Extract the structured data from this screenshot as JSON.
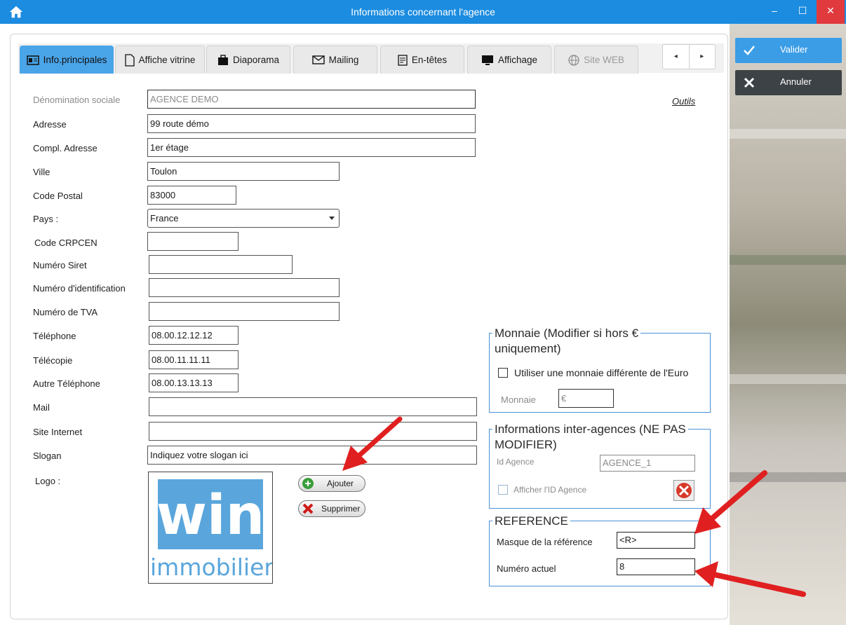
{
  "window": {
    "title": "Informations concernant l'agence",
    "close_label": "✕",
    "minimize_label": "–",
    "maximize_label": "☐"
  },
  "side": {
    "valider_label": "Valider",
    "annuler_label": "Annuler"
  },
  "tabs": [
    {
      "label": "Info.principales",
      "icon": "id-card-icon"
    },
    {
      "label": "Affiche vitrine",
      "icon": "document-icon"
    },
    {
      "label": "Diaporama",
      "icon": "briefcase-icon"
    },
    {
      "label": "Mailing",
      "icon": "envelope-icon"
    },
    {
      "label": "En-têtes",
      "icon": "header-doc-icon"
    },
    {
      "label": "Affichage",
      "icon": "monitor-icon"
    },
    {
      "label": "Site WEB",
      "icon": "globe-icon"
    }
  ],
  "nav": {
    "prev": "◂",
    "next": "▸"
  },
  "outils_label": "Outils",
  "form": {
    "denomination": {
      "label": "Dénomination sociale",
      "value": "AGENCE DEMO"
    },
    "adresse": {
      "label": "Adresse",
      "value": "99 route démo"
    },
    "compl_adresse": {
      "label": "Compl. Adresse",
      "value": "1er étage"
    },
    "ville": {
      "label": "Ville",
      "value": "Toulon"
    },
    "code_postal": {
      "label": "Code Postal",
      "value": "83000"
    },
    "pays": {
      "label": "Pays :",
      "value": "France"
    },
    "crpcen": {
      "label": "Code CRPCEN",
      "value": ""
    },
    "siret": {
      "label": "Numéro Siret",
      "value": ""
    },
    "identification": {
      "label": "Numéro d'identification",
      "value": ""
    },
    "tva": {
      "label": "Numéro de TVA",
      "value": ""
    },
    "telephone": {
      "label": "Téléphone",
      "value": "08.00.12.12.12"
    },
    "telecopie": {
      "label": "Télécopie",
      "value": "08.00.11.11.11"
    },
    "autre_tel": {
      "label": "Autre Téléphone",
      "value": "08.00.13.13.13"
    },
    "mail": {
      "label": "Mail",
      "value": ""
    },
    "site": {
      "label": "Site Internet",
      "value": ""
    },
    "slogan": {
      "label": "Slogan",
      "value": "Indiquez votre slogan ici"
    },
    "logo": {
      "label": "Logo :",
      "brand_top": "win",
      "brand_bottom": "immobilier"
    }
  },
  "logo_buttons": {
    "ajouter": "Ajouter",
    "supprimer": "Supprimer"
  },
  "monnaie": {
    "title_line1": "Monnaie (Modifier si hors €",
    "title_line2": "uniquement)",
    "checkbox_label": "Utiliser une monnaie différente de l'Euro",
    "field_label": "Monnaie",
    "field_value": "€"
  },
  "inter": {
    "title_line1": "Informations inter-agences (NE PAS",
    "title_line2": "MODIFIER)",
    "id_label": "Id Agence",
    "id_value": "AGENCE_1",
    "checkbox_label": "Afficher l'ID Agence"
  },
  "reference": {
    "title": "REFERENCE",
    "masque_label": "Masque de la référence",
    "masque_value": "<R>",
    "numero_label": "Numéro actuel",
    "numero_value": "8"
  },
  "colors": {
    "titlebar": "#1c8ce0",
    "accent": "#4aa4e8",
    "group_border": "#4a90d6",
    "arrow": "#e02020",
    "logo_blue": "#5aa6dc"
  }
}
